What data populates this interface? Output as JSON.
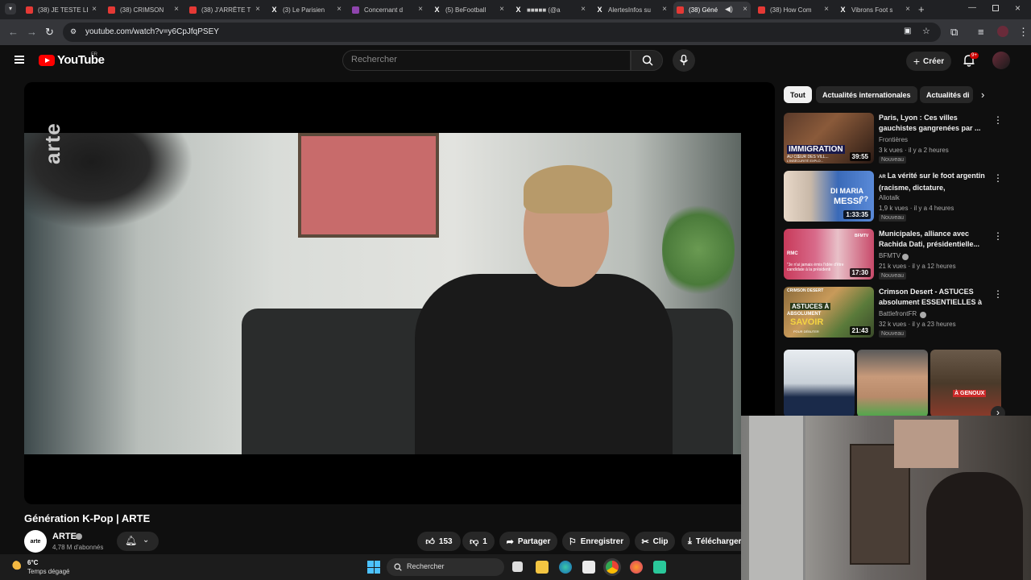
{
  "browser": {
    "tabs": [
      {
        "label": "(38) JE TESTE LE",
        "favicon": "youtube-icon"
      },
      {
        "label": "(38) CRIMSON",
        "favicon": "youtube-icon"
      },
      {
        "label": "(38) J'ARRÊTE T",
        "favicon": "youtube-icon"
      },
      {
        "label": "(3) Le Parisien",
        "favicon": "x-icon"
      },
      {
        "label": "Concernant d",
        "favicon": "twitch-icon"
      },
      {
        "label": "(5) BeFootball",
        "favicon": "x-icon"
      },
      {
        "label": "■■■■■ (@a",
        "favicon": "x-icon"
      },
      {
        "label": "AlertesInfos su",
        "favicon": "x-icon"
      },
      {
        "label": "(38) Géné",
        "favicon": "youtube-icon",
        "active": true
      },
      {
        "label": "(38) How Com",
        "favicon": "youtube-icon"
      },
      {
        "label": "Vibrons Foot s",
        "favicon": "x-icon"
      }
    ],
    "url": "youtube.com/watch?v=y6CpJfqPSEY"
  },
  "header": {
    "logo_text": "YouTube",
    "region": "FR",
    "search_placeholder": "Rechercher",
    "create_label": "Créer",
    "notifications_badge": "9+"
  },
  "video": {
    "watermark": "arte",
    "title": "Génération K-Pop | ARTE",
    "channel": {
      "name": "ARTE",
      "avatar_text": "arte",
      "subscribers": "4,78 M d'abonnés"
    },
    "actions": {
      "likes": "153",
      "dislikes": "1",
      "share": "Partager",
      "save": "Enregistrer",
      "clip": "Clip",
      "download": "Télécharger"
    }
  },
  "sidebar": {
    "chips": [
      "Tout",
      "Actualités internationales",
      "Actualités di"
    ],
    "recommendations": [
      {
        "title": "Paris, Lyon : Ces villes gauchistes gangrenées par ...",
        "channel": "Frontières",
        "meta": "3 k vues · il y a 2 heures",
        "badge": "Nouveau",
        "duration": "39:55",
        "thumb_text": "IMMIGRATION",
        "thumb_sub": "AU CŒUR DES VILL...",
        "thumb_sub2": "L'INSÉCURITÉ EXPLO...",
        "verified": false
      },
      {
        "title": "La vérité sur le foot argentin (racisme, dictature, Maradona,...",
        "title_prefix": "AR",
        "channel": "Aliotalk",
        "meta": "1,9 k vues · il y a 4 heures",
        "badge": "Nouveau",
        "duration": "1:33:35",
        "thumb_text": "DI MARIA",
        "thumb_sub": "MESSI",
        "thumb_q": "??",
        "verified": false
      },
      {
        "title": "Municipales, alliance avec Rachida Dati, présidentielle... ...",
        "channel": "BFMTV",
        "meta": "21 k vues · il y a 12 heures",
        "badge": "Nouveau",
        "duration": "17:30",
        "thumb_text": "\"Je n'ai jamais émis l'idée d'être candidate à la présidenti",
        "thumb_logo": "RMC",
        "thumb_logo2": "BFMTV",
        "verified": true
      },
      {
        "title": "Crimson Desert - ASTUCES absolument ESSENTIELLES à ...",
        "channel": "BattlefrontFR",
        "meta": "32 k vues · il y a 23 heures",
        "badge": "Nouveau",
        "duration": "21:43",
        "thumb_text": "ASTUCES À",
        "thumb_sub": "ABSOLUMENT",
        "thumb_sub2": "SAVOIR",
        "thumb_sub3": "POUR DÉBUTER",
        "thumb_logo": "CRIMSON DESERT",
        "verified": true
      }
    ],
    "shorts_caption": "À GENOUX"
  },
  "taskbar": {
    "temperature": "6°C",
    "weather": "Temps dégagé",
    "search_label": "Rechercher"
  },
  "colors": {
    "youtube_red": "#ff0000",
    "background": "#0f0f0f",
    "chip_active": "#f1f1f1",
    "badge_red": "#cc0000"
  }
}
